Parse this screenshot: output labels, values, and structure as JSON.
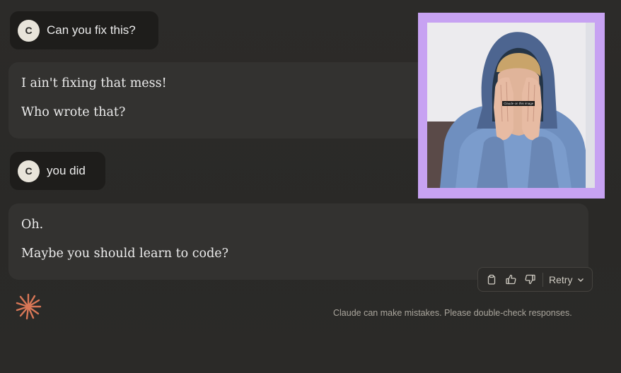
{
  "conversation": {
    "messages": [
      {
        "role": "user",
        "avatar_initial": "C",
        "text": "Can you fix this?"
      },
      {
        "role": "assistant",
        "lines": [
          "I ain't fixing that mess!",
          "Who wrote that?"
        ]
      },
      {
        "role": "user",
        "avatar_initial": "C",
        "text": "you did"
      },
      {
        "role": "assistant",
        "lines": [
          "Oh.",
          "Maybe you should learn to code?"
        ]
      }
    ]
  },
  "actions": {
    "copy_icon": "clipboard-icon",
    "thumbs_up_icon": "thumbs-up-icon",
    "thumbs_down_icon": "thumbs-down-icon",
    "retry_label": "Retry",
    "retry_chevron_icon": "chevron-down-icon"
  },
  "footer": {
    "disclaimer": "Claude can make mistakes. Please double-check responses.",
    "logo_icon": "claude-starburst-icon"
  },
  "meme": {
    "caption": "Claude on this image",
    "frame_color": "#c7a2f2"
  },
  "colors": {
    "background": "#2b2a28",
    "user_bubble": "#1e1d1b",
    "assistant_bubble": "#333230",
    "logo_accent": "#d97757"
  }
}
